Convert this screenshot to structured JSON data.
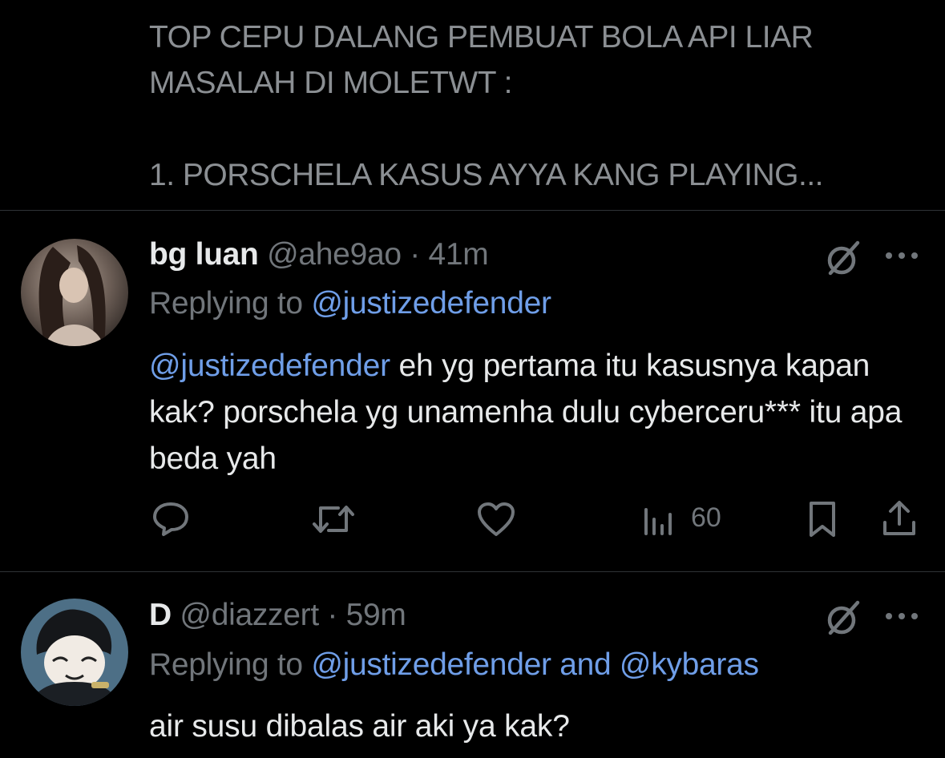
{
  "quoted_tweet": {
    "cut_line": "... ... ... ...",
    "lines": [
      "TOP CEPU DALANG PEMBUAT BOLA API LIAR",
      "MASALAH DI MOLETWT :",
      "",
      "1. PORSCHELA KASUS AYYA KANG PLAYING..."
    ]
  },
  "replies": [
    {
      "name": "bg luan",
      "handle": "@ahe9ao",
      "separator": "·",
      "time": "41m",
      "replying_prefix": "Replying to ",
      "replying_mentions": [
        "@justizedefender"
      ],
      "replying_joiner": "",
      "body_mention": "@justizedefender",
      "body_text": " eh yg pertama itu kasusnya kapan kak? porschela yg unamenha dulu cyberceru*** itu apa beda yah",
      "actions": {
        "reply_icon": "reply-icon",
        "retweet_icon": "retweet-icon",
        "like_icon": "heart-icon",
        "views_icon": "views-icon",
        "views": "60",
        "bookmark_icon": "bookmark-icon",
        "share_icon": "share-icon"
      }
    },
    {
      "name": "D",
      "handle": "@diazzert",
      "separator": "·",
      "time": "59m",
      "replying_prefix": "Replying to ",
      "replying_mentions": [
        "@justizedefender",
        "@kybaras"
      ],
      "replying_joiner": " and ",
      "body_text": "air susu dibalas air aki ya kak?"
    }
  ],
  "colors": {
    "background": "#000000",
    "text": "#e7e9ea",
    "secondary": "#71767b",
    "link": "#6f9ee8",
    "divider": "#2f3336"
  }
}
